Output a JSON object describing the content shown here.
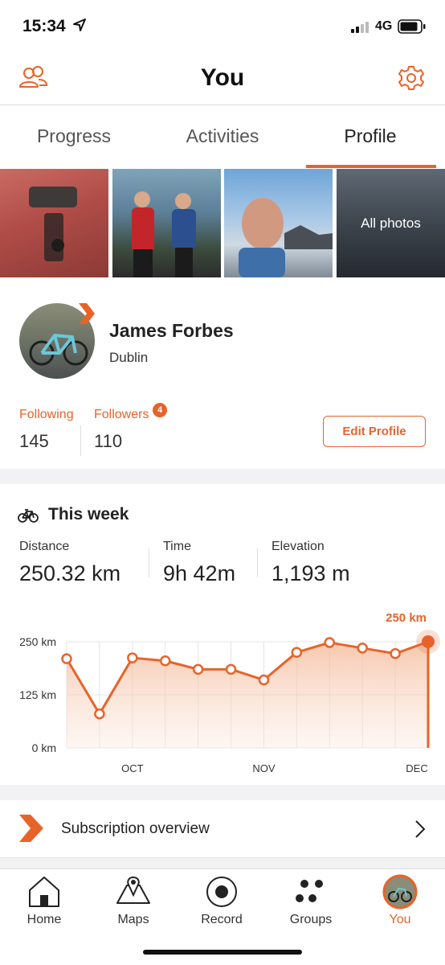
{
  "status_bar": {
    "time": "15:34",
    "network": "4G"
  },
  "header": {
    "title": "You",
    "left_icon": "people-icon",
    "right_icon": "gear-icon"
  },
  "tabs": [
    {
      "label": "Progress",
      "active": false
    },
    {
      "label": "Activities",
      "active": false
    },
    {
      "label": "Profile",
      "active": true
    }
  ],
  "photos": {
    "all_photos_label": "All photos"
  },
  "profile": {
    "name": "James Forbes",
    "location": "Dublin",
    "following_label": "Following",
    "following_count": "145",
    "followers_label": "Followers",
    "followers_count": "110",
    "followers_badge": "4",
    "edit_button": "Edit Profile"
  },
  "this_week": {
    "title": "This week",
    "metrics": [
      {
        "label": "Distance",
        "value": "250.32 km"
      },
      {
        "label": "Time",
        "value": "9h 42m"
      },
      {
        "label": "Elevation",
        "value": "1,193 m"
      }
    ]
  },
  "chart_data": {
    "type": "line",
    "x": [
      "",
      "",
      "OCT",
      "",
      "",
      "",
      "NOV",
      "",
      "",
      "",
      "",
      "DEC"
    ],
    "series": [
      {
        "values": [
          210,
          80,
          212,
          205,
          185,
          185,
          160,
          225,
          248,
          235,
          222,
          250
        ]
      }
    ],
    "ylim": [
      0,
      250
    ],
    "yticks": [
      "0 km",
      "125 km",
      "250 km"
    ],
    "xticks": [
      "OCT",
      "NOV",
      "DEC"
    ],
    "current_label": "250 km",
    "accent_color": "#e8632a",
    "grid": true
  },
  "subscription": {
    "label": "Subscription overview"
  },
  "bottom_nav": [
    {
      "label": "Home",
      "icon": "home-icon",
      "active": false
    },
    {
      "label": "Maps",
      "icon": "map-icon",
      "active": false
    },
    {
      "label": "Record",
      "icon": "record-icon",
      "active": false
    },
    {
      "label": "Groups",
      "icon": "groups-icon",
      "active": false
    },
    {
      "label": "You",
      "icon": "avatar",
      "active": true
    }
  ]
}
